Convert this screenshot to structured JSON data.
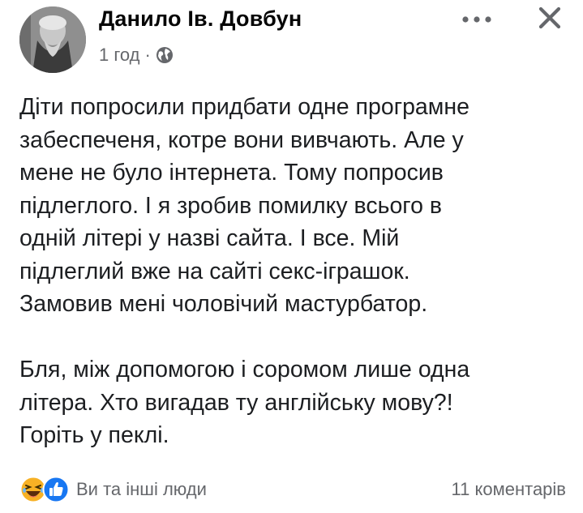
{
  "post": {
    "author": "Данило Ів. Довбун",
    "time": "1 год",
    "separator": "·",
    "privacy_icon": "globe-icon",
    "paragraphs": [
      "Діти попросили придбати одне програмне\nзабеспеченя, котре вони вивчають. Але у\nмене не було інтернета. Тому попросив\nпідлеглого. І я зробив помилку всього в\nодній літері у назві сайта. І все. Мій\nпідлеглий вже на сайті секс-іграшок.\nЗамовив мені чоловічий мастурбатор.",
      "Бля, між допомогою і соромом лише одна\nлітера. Хто вигадав ту англійську мову?!\nГоріть у пеклі."
    ],
    "reactions_text": "Ви та інші люди",
    "comments_text": "11 коментарів"
  },
  "icons": {
    "more": "more-horizontal-icon",
    "close": "close-icon",
    "reactions": [
      "haha-icon",
      "like-icon"
    ]
  },
  "colors": {
    "text": "#1c1e21",
    "secondary": "#65676b",
    "like_blue": "#1877f2",
    "haha_yellow": "#f7b125"
  }
}
